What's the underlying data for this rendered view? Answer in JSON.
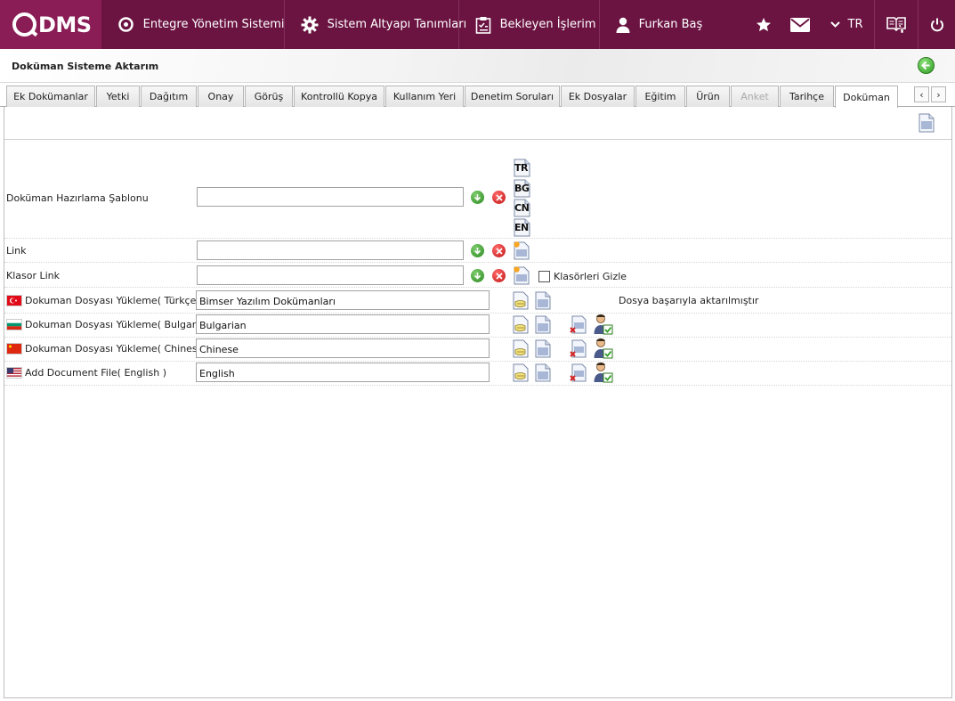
{
  "app": {
    "logo_text": "DMS",
    "nav": [
      {
        "label": "Entegre Yönetim Sistemi",
        "icon": "qdms-icon"
      },
      {
        "label": "Sistem Altyapı Tanımları",
        "icon": "gear-icon"
      },
      {
        "label": "Bekleyen İşlerim",
        "icon": "clipboard-icon"
      },
      {
        "label": "Furkan Baş",
        "icon": "user-icon"
      }
    ],
    "language": "TR"
  },
  "page": {
    "title": "Doküman Sisteme Aktarım"
  },
  "tabs": [
    {
      "label": "Ek Dokümanlar",
      "state": "normal"
    },
    {
      "label": "Yetki",
      "state": "normal"
    },
    {
      "label": "Dağıtım",
      "state": "normal"
    },
    {
      "label": "Onay",
      "state": "normal"
    },
    {
      "label": "Görüş",
      "state": "normal"
    },
    {
      "label": "Kontrollü Kopya",
      "state": "normal"
    },
    {
      "label": "Kullanım Yeri",
      "state": "normal"
    },
    {
      "label": "Denetim Soruları",
      "state": "normal"
    },
    {
      "label": "Ek Dosyalar",
      "state": "normal"
    },
    {
      "label": "Eğitim",
      "state": "normal"
    },
    {
      "label": "Ürün",
      "state": "normal"
    },
    {
      "label": "Anket",
      "state": "disabled"
    },
    {
      "label": "Tarihçe",
      "state": "normal"
    },
    {
      "label": "Doküman",
      "state": "active"
    }
  ],
  "form": {
    "template_label": "Doküman Hazırlama Şablonu",
    "template_value": "",
    "template_langs": [
      "TR",
      "BG",
      "CN",
      "EN"
    ],
    "link_label": "Link",
    "link_value": "",
    "folder_link_label": "Klasor Link",
    "folder_link_value": "",
    "hide_folders_label": "Klasörleri Gizle",
    "hide_folders_checked": false
  },
  "uploads": [
    {
      "label": "Dokuman Dosyası Yükleme( Türkçe )",
      "flag": "tr",
      "value": "Bimser Yazılım Dokümanları",
      "status": "Dosya başarıyla aktarılmıştır"
    },
    {
      "label": "Dokuman Dosyası Yükleme( Bulgarian )",
      "flag": "bg",
      "value": "Bulgarian",
      "status": ""
    },
    {
      "label": "Dokuman Dosyası Yükleme( Chinese )",
      "flag": "cn",
      "value": "Chinese",
      "status": ""
    },
    {
      "label": "Add Document File( English )",
      "flag": "us",
      "value": "English",
      "status": ""
    }
  ],
  "colors": {
    "brand": "#6b1442",
    "brand_light": "#8a1d55",
    "accept": "#2d8a22",
    "cancel": "#c21616"
  }
}
